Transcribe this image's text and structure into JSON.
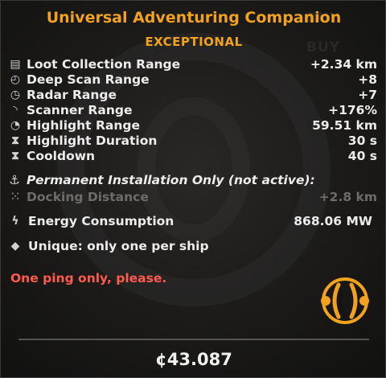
{
  "item": {
    "title": "Universal Adventuring Companion",
    "rarity": "EXCEPTIONAL",
    "ghost_buy": "BUY"
  },
  "stats": [
    {
      "icon": "loot-collection-icon",
      "glyph": "▤",
      "label": "Loot Collection Range",
      "value": "+2.34 km"
    },
    {
      "icon": "deep-scan-icon",
      "glyph": "◴",
      "label": "Deep Scan Range",
      "value": "+8"
    },
    {
      "icon": "radar-icon",
      "glyph": "◷",
      "label": "Radar Range",
      "value": "+7"
    },
    {
      "icon": "scanner-icon",
      "glyph": "◝",
      "label": "Scanner Range",
      "value": "+176%"
    },
    {
      "icon": "highlight-range-icon",
      "glyph": "◔",
      "label": "Highlight Range",
      "value": "59.51 km"
    },
    {
      "icon": "hourglass-icon",
      "glyph": "⧗",
      "label": "Highlight Duration",
      "value": "30 s"
    },
    {
      "icon": "cooldown-hourglass-icon",
      "glyph": "⧗",
      "label": "Cooldown",
      "value": "40 s"
    }
  ],
  "installation": {
    "icon": "anchor-icon",
    "glyph": "⚓",
    "heading": "Permanent Installation Only (not active):",
    "docking": {
      "icon": "docking-icon",
      "glyph": "⁙",
      "label": "Docking Distance",
      "value": "+2.8 km"
    }
  },
  "energy": {
    "icon": "lightning-icon",
    "glyph": "ϟ",
    "label": "Energy Consumption",
    "value": "868.06 MW"
  },
  "unique": {
    "icon": "diamond-icon",
    "glyph": "◆",
    "label": "Unique: only one per ship"
  },
  "flavor": "One ping only, please.",
  "price": "¢43.087",
  "colors": {
    "accent": "#f2a21c",
    "flavor": "#ff5a4d",
    "dim": "#6e6c69"
  }
}
